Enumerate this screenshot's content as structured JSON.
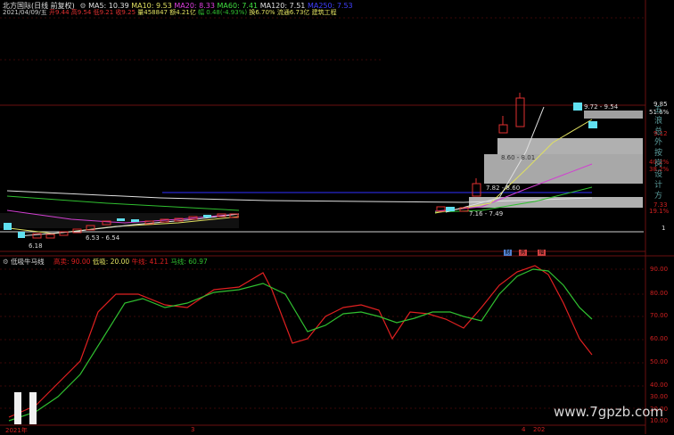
{
  "header": {
    "stock": "北方国际(日线 前复权)",
    "ma_icon": "gear-icon",
    "ma5": "MA5: 10.39",
    "ma10": "MA10: 9.53",
    "ma20": "MA20: 8.33",
    "ma60": "MA60: 7.41",
    "ma120": "MA120: 7.51",
    "ma250": "MA250: 7.53"
  },
  "info_line": {
    "date": "2021/04/09/五",
    "open": "开9.44",
    "high": "高9.54",
    "low": "低9.21",
    "close": "收9.25",
    "volume": "量458847",
    "amount": "额4.21亿",
    "change": "幅 0.48(-4.93%)",
    "turnover": "换6.70%",
    "float": "流通6.73亿",
    "sector": "建筑工程"
  },
  "price_axis": {
    "labels": [
      "9.85",
      "51.6%",
      "9.12",
      "40.2%",
      "38.2%",
      "7.33",
      "19.1%",
      "1"
    ]
  },
  "side_text": [
    "五",
    "浪",
    "总",
    "外",
    "按",
    "岗",
    "设",
    "计",
    "方"
  ],
  "annotations": [
    "9.72 - 9.54",
    "8.60 - 8.01",
    "7.82 - 8.60",
    "7.16 - 7.49",
    "6.53 - 6.54",
    "6.18"
  ],
  "tabs": [
    "财",
    "务",
    "增"
  ],
  "indicator": {
    "title": "低吸牛马线",
    "top": "高卖: 90.00",
    "bottom": "低吸: 20.00",
    "bull": "牛线: 41.21",
    "horse": "马线: 60.97"
  },
  "indicator_axis": [
    "90.00",
    "80.00",
    "70.00",
    "60.00",
    "50.00",
    "40.00",
    "30.00",
    "20.00",
    "10.00"
  ],
  "dates": [
    "2021年",
    "3",
    "4",
    "202"
  ],
  "watermark": "www.7gpzb.com",
  "colors": {
    "bull_line": "#e02020",
    "horse_line": "#30c030",
    "axis": "#d02020",
    "candle_up": "#e03030",
    "candle_down": "#60e0f0"
  }
}
